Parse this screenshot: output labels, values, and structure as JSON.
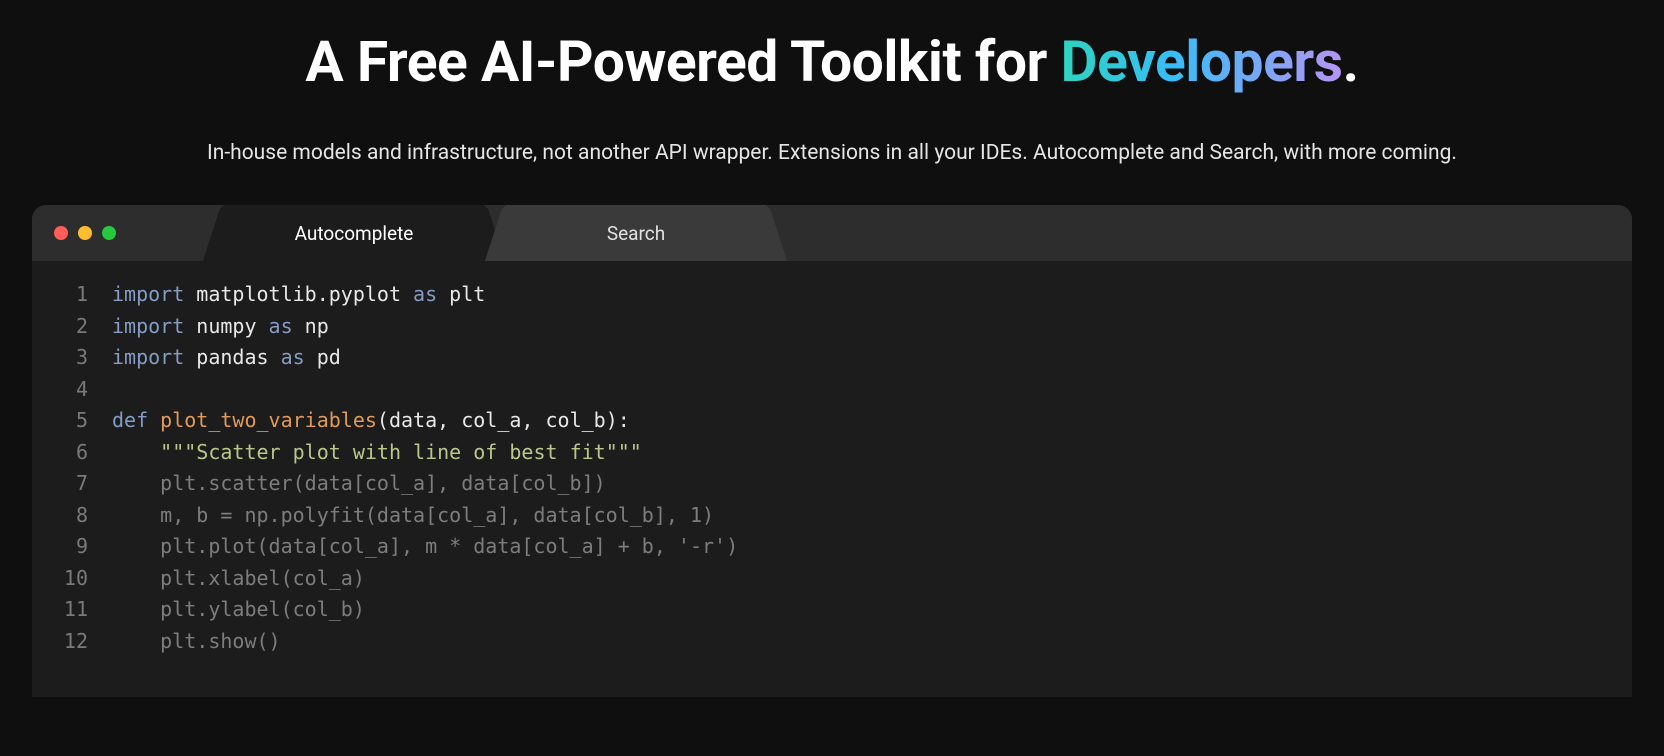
{
  "headline_prefix": "A Free AI-Powered Toolkit for ",
  "headline_highlight": "Developers",
  "headline_suffix": ".",
  "subhead": "In-house models and infrastructure, not another API wrapper. Extensions in all your IDEs. Autocomplete and Search, with more coming.",
  "tabs": {
    "autocomplete": "Autocomplete",
    "search": "Search"
  },
  "code_lines": [
    {
      "n": "1",
      "tokens": [
        {
          "cls": "tk-kw",
          "t": "import"
        },
        {
          "cls": "tk-plain",
          "t": " matplotlib.pyplot "
        },
        {
          "cls": "tk-kw",
          "t": "as"
        },
        {
          "cls": "tk-plain",
          "t": " plt"
        }
      ]
    },
    {
      "n": "2",
      "tokens": [
        {
          "cls": "tk-kw",
          "t": "import"
        },
        {
          "cls": "tk-plain",
          "t": " numpy "
        },
        {
          "cls": "tk-kw",
          "t": "as"
        },
        {
          "cls": "tk-plain",
          "t": " np"
        }
      ]
    },
    {
      "n": "3",
      "tokens": [
        {
          "cls": "tk-kw",
          "t": "import"
        },
        {
          "cls": "tk-plain",
          "t": " pandas "
        },
        {
          "cls": "tk-kw",
          "t": "as"
        },
        {
          "cls": "tk-plain",
          "t": " pd"
        }
      ]
    },
    {
      "n": "4",
      "tokens": []
    },
    {
      "n": "5",
      "tokens": [
        {
          "cls": "tk-kw",
          "t": "def"
        },
        {
          "cls": "tk-plain",
          "t": " "
        },
        {
          "cls": "tk-def",
          "t": "plot_two_variables"
        },
        {
          "cls": "tk-plain",
          "t": "(data, col_a, col_b):"
        }
      ]
    },
    {
      "n": "6",
      "tokens": [
        {
          "cls": "tk-plain",
          "t": "    "
        },
        {
          "cls": "tk-str",
          "t": "\"\"\"Scatter plot with line of best fit\"\"\""
        }
      ]
    },
    {
      "n": "7",
      "tokens": [
        {
          "cls": "tk-ghost",
          "t": "    plt.scatter(data[col_a], data[col_b])"
        }
      ]
    },
    {
      "n": "8",
      "tokens": [
        {
          "cls": "tk-ghost",
          "t": "    m, b = np.polyfit(data[col_a], data[col_b], 1)"
        }
      ]
    },
    {
      "n": "9",
      "tokens": [
        {
          "cls": "tk-ghost",
          "t": "    plt.plot(data[col_a], m * data[col_a] + b, '-r')"
        }
      ]
    },
    {
      "n": "10",
      "tokens": [
        {
          "cls": "tk-ghost",
          "t": "    plt.xlabel(col_a)"
        }
      ]
    },
    {
      "n": "11",
      "tokens": [
        {
          "cls": "tk-ghost",
          "t": "    plt.ylabel(col_b)"
        }
      ]
    },
    {
      "n": "12",
      "tokens": [
        {
          "cls": "tk-ghost",
          "t": "    plt.show()"
        }
      ]
    }
  ]
}
